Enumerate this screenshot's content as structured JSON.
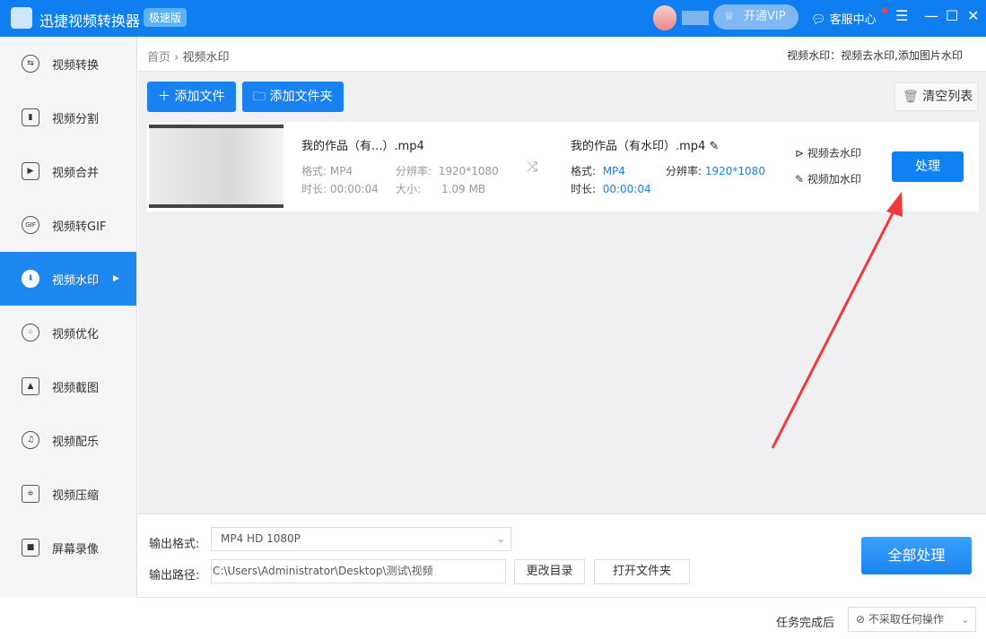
{
  "app": {
    "title": "迅捷视频转换器",
    "edition": "极速版",
    "vip": "开通VIP",
    "service": "客服中心"
  },
  "sidebar": {
    "items": [
      {
        "label": "视频转换",
        "icon": "swap-icon"
      },
      {
        "label": "视频分割",
        "icon": "split-icon"
      },
      {
        "label": "视频合并",
        "icon": "merge-icon"
      },
      {
        "label": "视频转GIF",
        "icon": "gif-icon"
      },
      {
        "label": "视频水印",
        "icon": "watermark-icon"
      },
      {
        "label": "视频优化",
        "icon": "film-reel-icon"
      },
      {
        "label": "视频截图",
        "icon": "image-icon"
      },
      {
        "label": "视频配乐",
        "icon": "music-icon"
      },
      {
        "label": "视频压缩",
        "icon": "compress-icon"
      },
      {
        "label": "屏幕录像",
        "icon": "camera-icon"
      }
    ]
  },
  "breadcrumb": {
    "home": "首页",
    "current": "视频水印"
  },
  "hint": "视频水印：视频去水印,添加图片水印",
  "toolbar": {
    "add_file": "添加文件",
    "add_folder": "添加文件夹",
    "clear": "清空列表"
  },
  "file": {
    "src_name": "我的作品（有...）.mp4",
    "format_label": "格式:",
    "format": "MP4",
    "res_label": "分辨率:",
    "resolution": "1920*1080",
    "dur_label": "时长:",
    "duration": "00:00:04",
    "size_label": "大小:",
    "size": "1.09 MB",
    "out_name": "我的作品（有水印）.mp4",
    "out_format": "MP4",
    "out_resolution": "1920*1080",
    "out_duration": "00:00:04",
    "remove_wm": "视频去水印",
    "add_wm": "视频加水印",
    "process": "处理"
  },
  "output": {
    "format_label": "输出格式:",
    "format": "MP4  HD 1080P",
    "path_label": "输出路径:",
    "path": "C:\\Users\\Administrator\\Desktop\\测试\\视频",
    "change_dir": "更改目录",
    "open_folder": "打开文件夹",
    "process_all": "全部处理"
  },
  "footer": {
    "label": "任务完成后",
    "option": "不采取任何操作"
  }
}
